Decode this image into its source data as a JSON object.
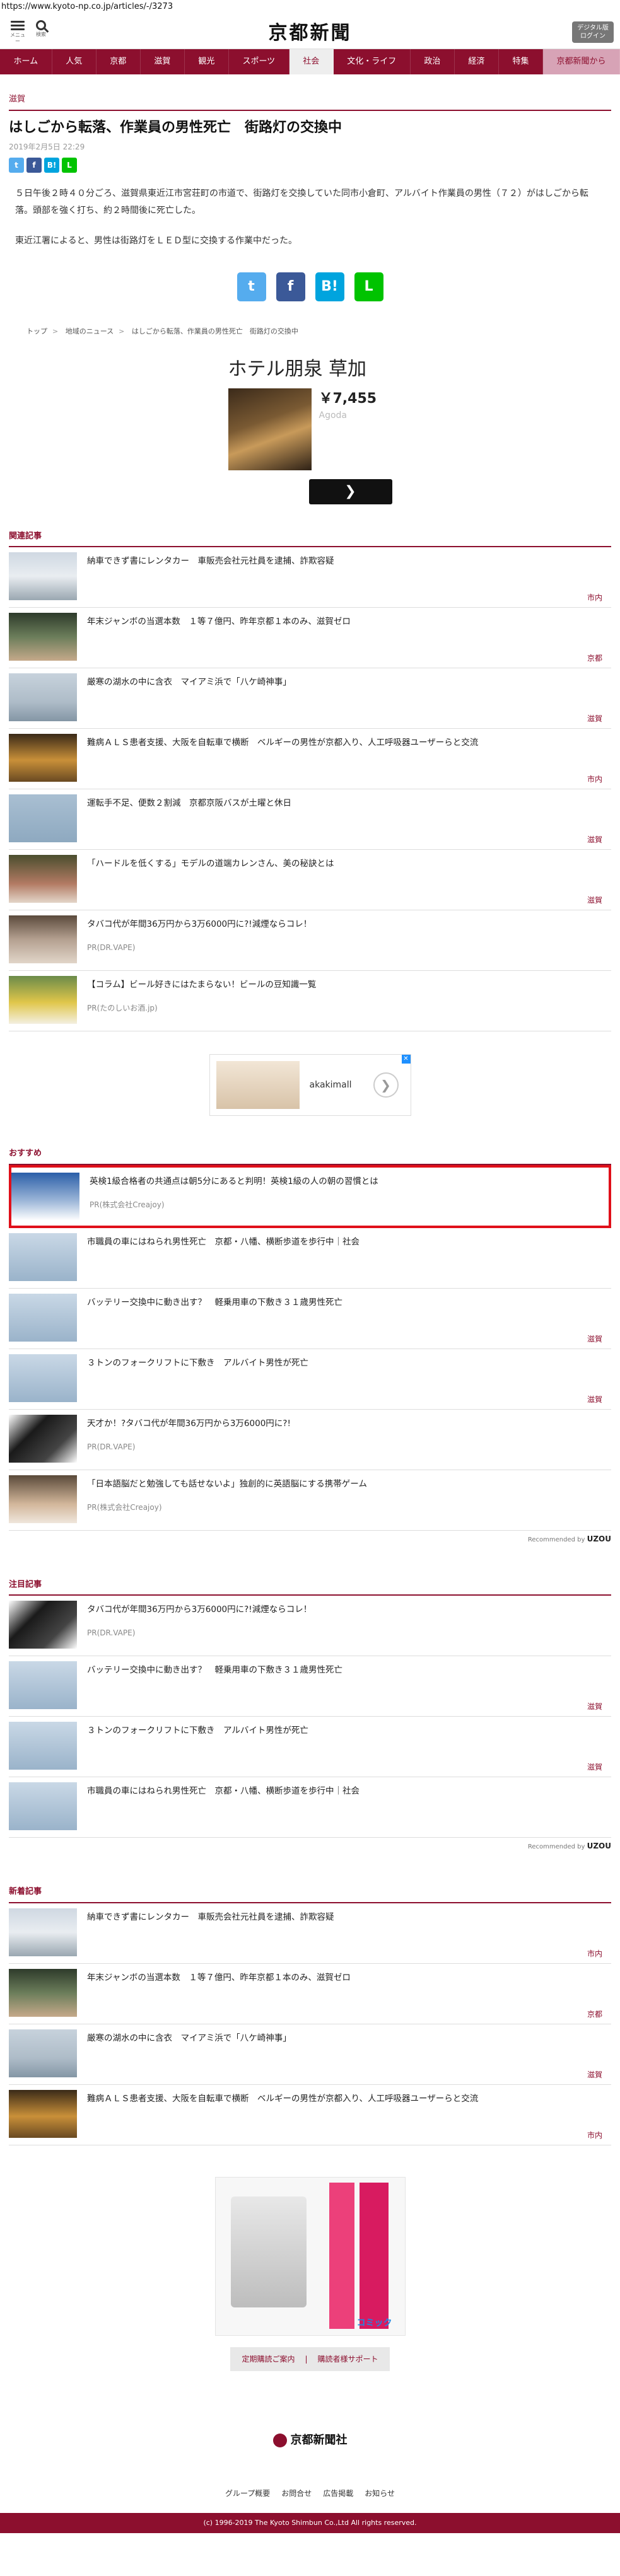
{
  "url": "https://www.kyoto-np.co.jp/articles/-/3273",
  "header": {
    "menu_label": "メニュー",
    "search_label": "検索",
    "logo": "京都新聞",
    "digital_btn_line1": "デジタル版",
    "digital_btn_line2": "ログイン"
  },
  "nav": [
    {
      "label": "ホーム"
    },
    {
      "label": "人気"
    },
    {
      "label": "京都"
    },
    {
      "label": "滋賀"
    },
    {
      "label": "観光"
    },
    {
      "label": "スポーツ"
    },
    {
      "label": "社会"
    },
    {
      "label": "文化・ライフ"
    },
    {
      "label": "政治"
    },
    {
      "label": "経済"
    },
    {
      "label": "特集"
    },
    {
      "label": "京都新聞から"
    }
  ],
  "article": {
    "category": "滋賀",
    "title": "はしごから転落、作業員の男性死亡　街路灯の交換中",
    "date": "2019年2月5日 22:29",
    "paragraph1": "５日午後２時４０分ごろ、滋賀県東近江市宮荘町の市道で、街路灯を交換していた同市小倉町、アルバイト作業員の男性（７２）がはしごから転落。頭部を強く打ち、約２時間後に死亡した。",
    "paragraph2": "東近江署によると、男性は街路灯をＬＥＤ型に交換する作業中だった。"
  },
  "share": {
    "twitter": "t",
    "facebook": "f",
    "hatena": "B!",
    "line": "L"
  },
  "breadcrumb": [
    "トップ",
    "地域のニュース",
    "はしごから転落、作業員の男性死亡　街路灯の交換中"
  ],
  "ad_hotel": {
    "title": "ホテル朋泉 草加",
    "price": "￥7,455",
    "provider": "Agoda",
    "go_label": "❯"
  },
  "related": {
    "title": "関連記事",
    "items": [
      {
        "text": "納車できず書にレンタカー　車販売会社元社員を逮捕、詐欺容疑",
        "tag": "市内"
      },
      {
        "text": "年末ジャンボの当選本数　１等７億円、昨年京都１本のみ、滋賀ゼロ",
        "tag": "京都"
      },
      {
        "text": "厳寒の湖水の中に含衣　マイアミ浜で「八ケ崎神事」",
        "tag": "滋賀"
      },
      {
        "text": "難病ＡＬＳ患者支援、大阪を自転車で横断　ベルギーの男性が京都入り、人工呼吸器ユーザーらと交流",
        "tag": "市内"
      },
      {
        "text": "運転手不足、便数２割減　京都京阪バスが土曜と休日",
        "tag": "滋賀"
      },
      {
        "text": "「ハードルを低くする」モデルの道端カレンさん、美の秘訣とは",
        "tag": "滋賀"
      },
      {
        "text": "タバコ代が年間36万円から3万6000円に?!減煙ならコレ！",
        "src": "PR(DR.VAPE)"
      },
      {
        "text": "【コラム】ビール好きにはたまらない！ビールの豆知識一覧",
        "src": "PR(たのしいお酒.jp)"
      }
    ]
  },
  "ad_shoe": {
    "brand": "akakimall",
    "arrow": "❯",
    "close": "✕"
  },
  "recommend": {
    "title": "おすすめ",
    "items": [
      {
        "text": "英検1級合格者の共通点は朝5分にあると判明！英検1級の人の朝の習慣とは",
        "src": "PR(株式会社Creajoy)",
        "highlight": true
      },
      {
        "text": "市職員の車にはねられ男性死亡　京都・八幡、横断歩道を歩行中｜社会"
      },
      {
        "text": "バッテリー交換中に動き出す？　軽乗用車の下敷き３１歳男性死亡",
        "tag": "滋賀"
      },
      {
        "text": "３トンのフォークリフトに下敷き　アルバイト男性が死亡",
        "tag": "滋賀"
      },
      {
        "text": "天才か！?タバコ代が年間36万円から3万6000円に?!",
        "src": "PR(DR.VAPE)"
      },
      {
        "text": "「日本語脳だと勉強しても話せないよ」独創的に英語脳にする携帯ゲーム",
        "src": "PR(株式会社Creajoy)"
      }
    ],
    "reco_prefix": "Recommended by",
    "reco_brand": "UZOU"
  },
  "attention": {
    "title": "注目記事",
    "items": [
      {
        "text": "タバコ代が年間36万円から3万6000円に?!減煙ならコレ！",
        "src": "PR(DR.VAPE)"
      },
      {
        "text": "バッテリー交換中に動き出す？　軽乗用車の下敷き３１歳男性死亡",
        "tag": "滋賀"
      },
      {
        "text": "３トンのフォークリフトに下敷き　アルバイト男性が死亡",
        "tag": "滋賀"
      },
      {
        "text": "市職員の車にはねられ男性死亡　京都・八幡、横断歩道を歩行中｜社会"
      }
    ],
    "reco_prefix": "Recommended by",
    "reco_brand": "UZOU"
  },
  "latest": {
    "title": "新着記事",
    "items": [
      {
        "text": "納車できず書にレンタカー　車販売会社元社員を逮捕、詐欺容疑",
        "tag": "市内"
      },
      {
        "text": "年末ジャンボの当選本数　１等７億円、昨年京都１本のみ、滋賀ゼロ",
        "tag": "京都"
      },
      {
        "text": "厳寒の湖水の中に含衣　マイアミ浜で「八ケ崎神事」",
        "tag": "滋賀"
      },
      {
        "text": "難病ＡＬＳ患者支援、大阪を自転車で横断　ベルギーの男性が京都入り、人工呼吸器ユーザーらと交流",
        "tag": "市内"
      }
    ]
  },
  "ad_manga": {
    "text": "コミック"
  },
  "footer": {
    "link1": "定期購読ご案内",
    "link2": "購読者様サポート",
    "logo": "京都新聞社",
    "nav": [
      "グループ概要",
      "お問合せ",
      "広告掲載",
      "お知らせ"
    ],
    "copyright": "(c) 1996-2019 The Kyoto Shimbun Co.,Ltd All rights reserved."
  },
  "colors": {
    "brand": "#8c0f2e",
    "highlight": "#e0101a",
    "twitter": "#55acee",
    "facebook": "#3b5998",
    "hatena": "#00a4de",
    "line": "#00c300"
  }
}
